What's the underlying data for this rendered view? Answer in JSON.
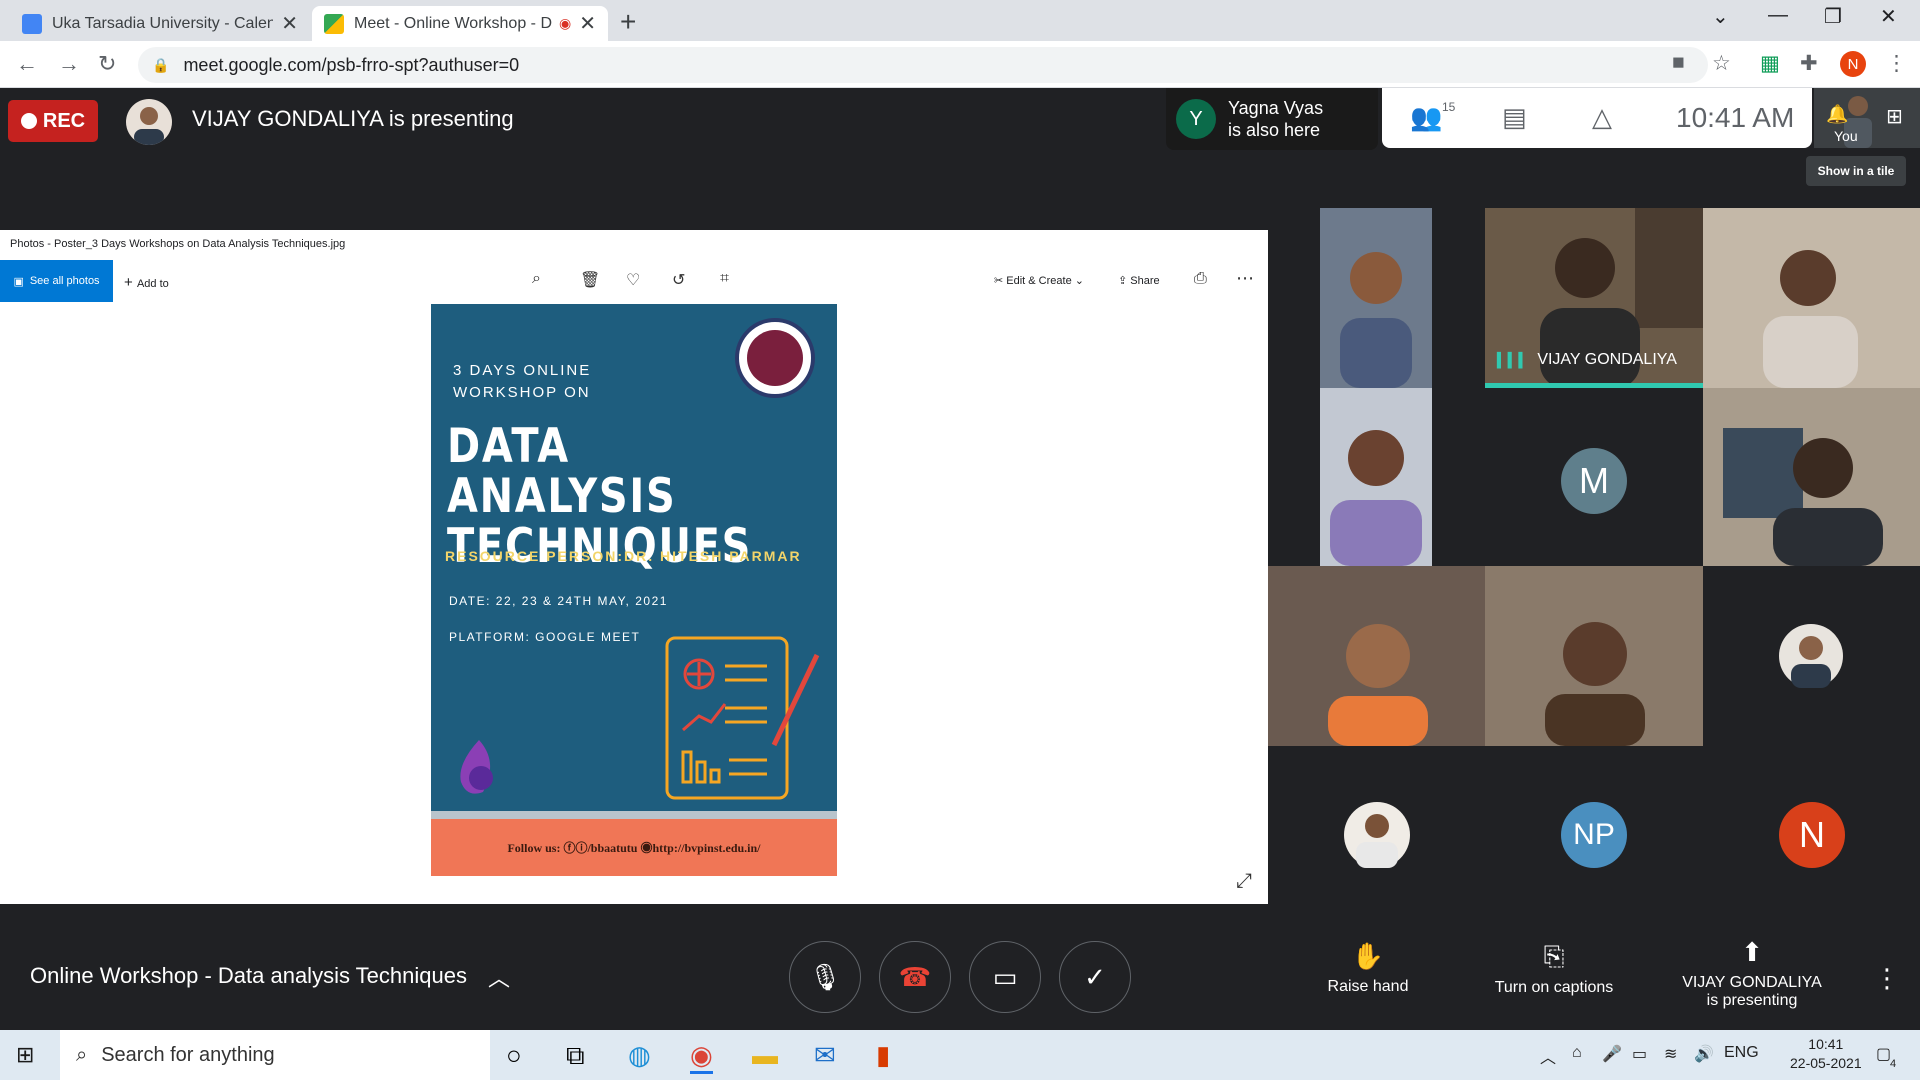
{
  "browser": {
    "tabs": [
      {
        "title": "Uka Tarsadia University - Calenda",
        "active": false
      },
      {
        "title": "Meet - Online Workshop - D",
        "active": true
      }
    ],
    "url": "meet.google.com/psb-frro-spt?authuser=0",
    "profile_initial": "N"
  },
  "meet": {
    "rec_label": "REC",
    "presenting_banner": "VIJAY GONDALIYA is presenting",
    "also_here": {
      "initial": "Y",
      "line1": "Yagna Vyas",
      "line2": "is also here"
    },
    "people_count": "15",
    "time": "10:41  AM",
    "you_label": "You",
    "tile_tooltip": "Show in a tile",
    "meeting_title": "Online Workshop - Data analysis Techniques",
    "controls": {
      "raise_hand": "Raise hand",
      "captions": "Turn on captions",
      "presenting_line1": "VIJAY GONDALIYA",
      "presenting_line2": "is presenting"
    },
    "participants": [
      {
        "name": "",
        "type": "video"
      },
      {
        "name": "VIJAY GONDALIYA",
        "type": "video",
        "speaking": true
      },
      {
        "name": "",
        "type": "video"
      },
      {
        "name": "",
        "type": "video"
      },
      {
        "name": "",
        "type": "avatar",
        "initial": "M",
        "color": "#5f7f8c"
      },
      {
        "name": "",
        "type": "video"
      },
      {
        "name": "",
        "type": "video"
      },
      {
        "name": "",
        "type": "video"
      },
      {
        "name": "",
        "type": "photo-avatar"
      },
      {
        "name": "",
        "type": "photo-avatar"
      },
      {
        "name": "",
        "type": "avatar",
        "initial": "NP",
        "color": "#4a8fbf"
      },
      {
        "name": "",
        "type": "avatar",
        "initial": "N",
        "color": "#d8401a"
      }
    ]
  },
  "photos_app": {
    "window_title": "Photos - Poster_3 Days Workshops on Data Analysis Techniques.jpg",
    "see_all": "See all photos",
    "add_to": "Add to",
    "edit_create": "Edit & Create",
    "share": "Share"
  },
  "poster": {
    "subtitle_line1": "3 DAYS ONLINE",
    "subtitle_line2": "WORKSHOP ON",
    "title_line1": "DATA ANALYSIS",
    "title_line2": "TECHNIQUES",
    "resource": "RESOURCE PERSON:DR. HITESH PARMAR",
    "date": "DATE: 22, 23 & 24TH MAY, 2021",
    "platform": "PLATFORM: GOOGLE MEET",
    "footer": "Follow us: ⓕⓘ/bbaatutu ◉http://bvpinst.edu.in/"
  },
  "taskbar": {
    "search_placeholder": "Search for anything",
    "lang": "ENG",
    "time": "10:41",
    "date": "22-05-2021",
    "notif_count": "4"
  }
}
